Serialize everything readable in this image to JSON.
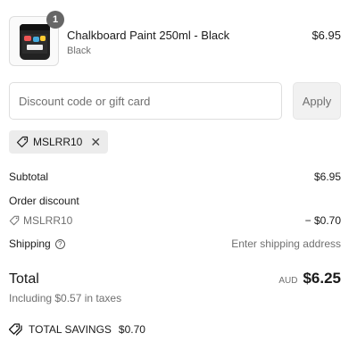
{
  "product": {
    "quantity": "1",
    "name": "Chalkboard Paint 250ml - Black",
    "variant": "Black",
    "price": "$6.95"
  },
  "discount": {
    "placeholder": "Discount code or gift card",
    "apply_label": "Apply",
    "applied_code": "MSLRR10",
    "remove_symbol": "✕"
  },
  "summary": {
    "subtotal_label": "Subtotal",
    "subtotal_value": "$6.95",
    "order_discount_label": "Order discount",
    "discount_code": "MSLRR10",
    "discount_value": "− $0.70",
    "shipping_label": "Shipping",
    "shipping_value": "Enter shipping address",
    "total_label": "Total",
    "currency": "AUD",
    "total_value": "$6.25",
    "taxes_note": "Including $0.57 in taxes",
    "savings_label": "TOTAL SAVINGS",
    "savings_value": "$0.70"
  },
  "icons": {
    "tag": "tag-icon",
    "info": "info-icon",
    "savings": "savings-tag-icon"
  },
  "colors": {
    "text": "#1a1a1a",
    "muted": "#707070",
    "border": "#dedede",
    "chip_bg": "#ececec",
    "badge_bg": "#666666"
  }
}
